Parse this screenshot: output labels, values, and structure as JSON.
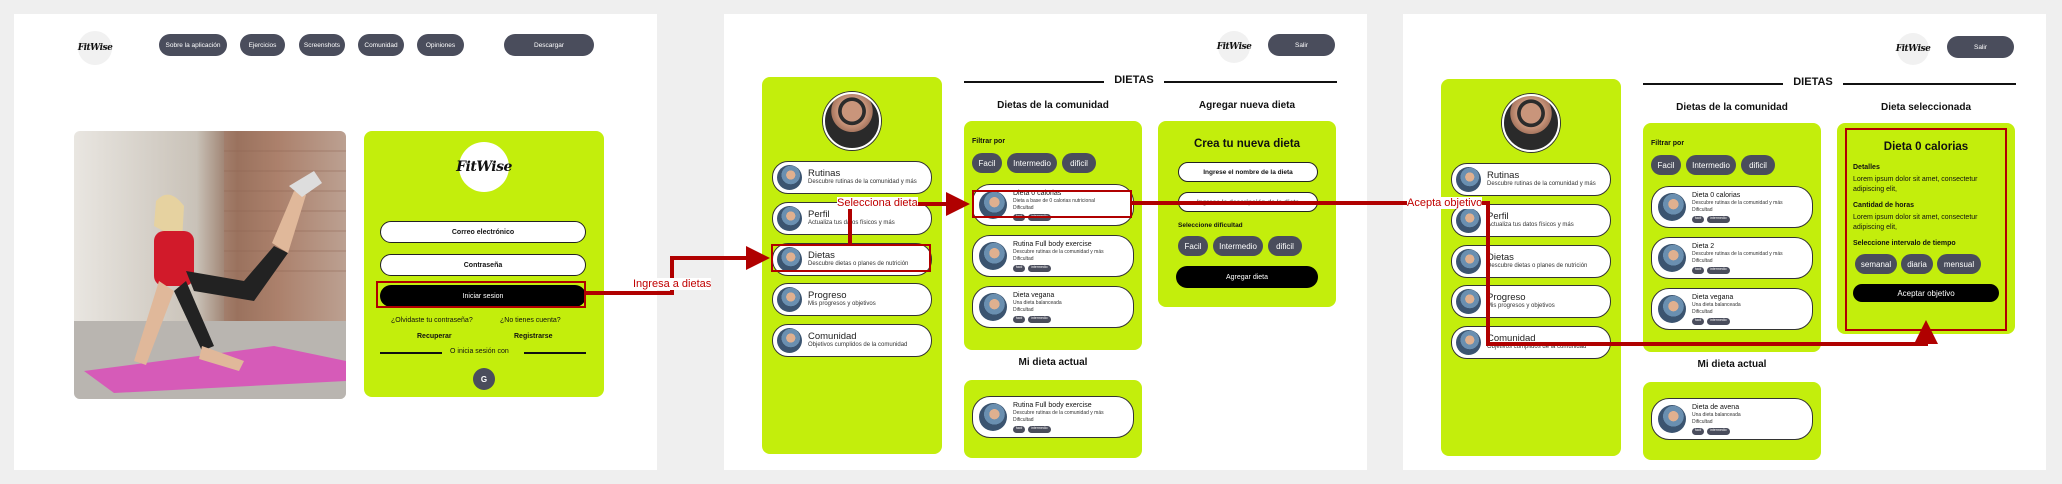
{
  "brand": {
    "logo_text": "FitWise"
  },
  "landing": {
    "nav": [
      "Sobre la aplicación",
      "Ejercicios",
      "Screenshots",
      "Comunidad",
      "Opiniones"
    ],
    "download": "Descargar",
    "login": {
      "email": "Correo electrónico",
      "password": "Contraseña",
      "submit": "Iniciar sesion",
      "forgot": "¿Olvidaste tu contraseña?",
      "no_account": "¿No tienes cuenta?",
      "recover": "Recuperar",
      "register": "Registrarse",
      "or_with": "O inicia sesión con",
      "google": "G"
    }
  },
  "app": {
    "logout": "Salir",
    "section_title": "DIETAS",
    "sidebar": [
      {
        "title": "Rutinas",
        "desc": "Descubre rutinas de la comunidad y más"
      },
      {
        "title": "Perfil",
        "desc": "Actualiza tus datos físicos y más"
      },
      {
        "title": "Dietas",
        "desc": "Descubre dietas o planes de nutrición"
      },
      {
        "title": "Progreso",
        "desc": "Mis progresos y objetivos"
      },
      {
        "title": "Comunidad",
        "desc": "Objetivos cumplidos de la comunidad"
      }
    ],
    "community_title": "Dietas  de la comunidad",
    "filter_label": "Filtrar por",
    "filters": [
      "Facil",
      "Intermedio",
      "dificil"
    ],
    "tag_easy": "facil",
    "tag_mid": "intermedio",
    "diff_label": "Dificultad",
    "community_cards_2": [
      {
        "title": "Dieta 0 calorias",
        "desc": "Dieta a base de 0 calorias nutricional"
      },
      {
        "title": "Rutina Full body exercise",
        "desc": "Descubre rutinas de la comunidad y más"
      },
      {
        "title": "Dieta vegana",
        "desc": "Una dieta balanceada"
      }
    ],
    "my_diet_title": "Mi dieta actual",
    "my_diet_2": {
      "title": "Rutina Full body exercise",
      "desc": "Descubre rutinas de la comunidad y más"
    },
    "new_diet_title": "Agregar nueva dieta",
    "new_diet": {
      "heading": "Crea tu nueva dieta",
      "name_field": "Ingrese el nombre de la dieta",
      "desc_field": "Ingrese la descripción de la dieta",
      "difficulty_label": "Seleccione dificultad",
      "add_button": "Agregar dieta"
    },
    "community_cards_3": [
      {
        "title": "Dieta 0 calorias",
        "desc": "Descubre rutinas de la comunidad y más"
      },
      {
        "title": "Dieta 2",
        "desc": "Descubre rutinas de la comunidad y más"
      },
      {
        "title": "Dieta vegana",
        "desc": "Una dieta balanceada"
      }
    ],
    "my_diet_3": {
      "title": "Dieta de avena",
      "desc": "Una dieta balanceada"
    },
    "selected_title": "Dieta seleccionada",
    "selected": {
      "name": "Dieta 0 calorias",
      "details_label": "Detalles",
      "details_text_1": "Lorem ipsum dolor sit amet, consectetur",
      "details_text_2": "adipiscing elit,",
      "hours_label": "Cantidad de horas",
      "hours_text_1": "Lorem ipsum dolor sit amet, consectetur",
      "hours_text_2": "adipiscing elit,",
      "interval_label": "Seleccione intervalo de tiempo",
      "intervals": [
        "semanal",
        "diaria",
        "mensual"
      ],
      "accept": "Aceptar objetivo"
    }
  },
  "annotations": {
    "to_diets": "Ingresa a dietas",
    "select_diet": "Selecciona dieta",
    "accept_goal": "Acepta objetivo"
  },
  "colors": {
    "accent": "#c3ee0c",
    "pill": "#4a4d5c",
    "annotation": "#b00000"
  }
}
